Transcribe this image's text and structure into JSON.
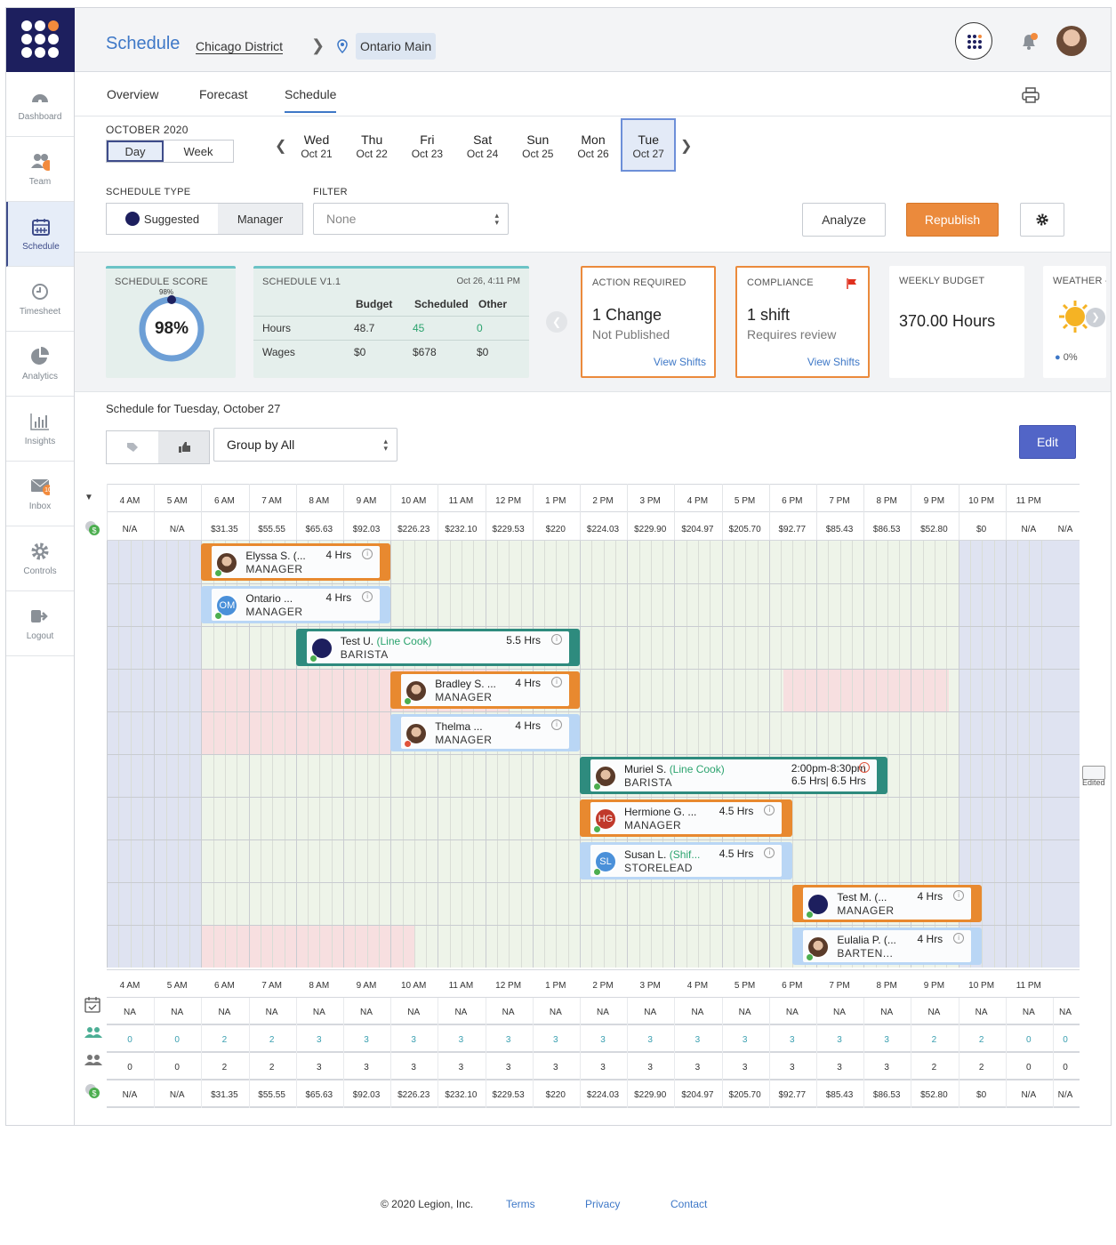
{
  "header": {
    "title": "Schedule",
    "district": "Chicago District",
    "location": "Ontario Main"
  },
  "sidebar": {
    "items": [
      {
        "label": "Dashboard",
        "icon": "dashboard-icon"
      },
      {
        "label": "Team",
        "icon": "team-icon",
        "badge": ""
      },
      {
        "label": "Schedule",
        "icon": "calendar-icon",
        "active": true
      },
      {
        "label": "Timesheet",
        "icon": "clock-icon"
      },
      {
        "label": "Analytics",
        "icon": "pie-chart-icon"
      },
      {
        "label": "Insights",
        "icon": "bar-chart-icon"
      },
      {
        "label": "Inbox",
        "icon": "mail-icon",
        "badge": "10"
      },
      {
        "label": "Controls",
        "icon": "gear-icon"
      },
      {
        "label": "Logout",
        "icon": "logout-icon"
      }
    ]
  },
  "tabs": [
    "Overview",
    "Forecast",
    "Schedule"
  ],
  "period": {
    "month": "OCTOBER 2020",
    "view_day": "Day",
    "view_week": "Week"
  },
  "days": [
    {
      "dow": "Wed",
      "date": "Oct 21"
    },
    {
      "dow": "Thu",
      "date": "Oct 22"
    },
    {
      "dow": "Fri",
      "date": "Oct 23"
    },
    {
      "dow": "Sat",
      "date": "Oct 24"
    },
    {
      "dow": "Sun",
      "date": "Oct 25"
    },
    {
      "dow": "Mon",
      "date": "Oct 26"
    },
    {
      "dow": "Tue",
      "date": "Oct 27",
      "selected": true
    }
  ],
  "controls": {
    "schedule_type_label": "SCHEDULE TYPE",
    "suggested": "Suggested",
    "manager": "Manager",
    "filter_label": "FILTER",
    "filter_value": "None",
    "analyze": "Analyze",
    "republish": "Republish"
  },
  "cards": {
    "score": {
      "title": "SCHEDULE SCORE",
      "small": "98%",
      "value": "98%",
      "fraction": 0.98
    },
    "version": {
      "title": "SCHEDULE V1.1",
      "timestamp": "Oct 26, 4:11 PM",
      "cols": [
        "Budget",
        "Scheduled",
        "Other"
      ],
      "rows": [
        {
          "label": "Hours",
          "values": [
            "48.7",
            "45",
            "0"
          ]
        },
        {
          "label": "Wages",
          "values": [
            "$0",
            "$678",
            "$0"
          ]
        }
      ]
    },
    "action": {
      "title": "ACTION REQUIRED",
      "value": "1 Change",
      "sub": "Not Published",
      "link": "View Shifts"
    },
    "compliance": {
      "title": "COMPLIANCE",
      "value": "1 shift",
      "sub": "Requires review",
      "link": "View Shifts"
    },
    "budget": {
      "title": "WEEKLY BUDGET",
      "value": "370.00 Hours"
    },
    "weather": {
      "title": "WEATHER -",
      "precip": "0%"
    }
  },
  "schedule": {
    "title": "Schedule for Tuesday, October 27",
    "group_by": "Group by All",
    "edit": "Edit",
    "edited": "Edited"
  },
  "hours": [
    "4 AM",
    "5 AM",
    "6 AM",
    "7 AM",
    "8 AM",
    "9 AM",
    "10 AM",
    "11 AM",
    "12 PM",
    "1 PM",
    "2 PM",
    "3 PM",
    "4 PM",
    "5 PM",
    "6 PM",
    "7 PM",
    "8 PM",
    "9 PM",
    "10 PM",
    "11 PM"
  ],
  "top_wages": [
    "N/A",
    "N/A",
    "$31.35",
    "$55.55",
    "$65.63",
    "$92.03",
    "$226.23",
    "$232.10",
    "$229.53",
    "$220",
    "$224.03",
    "$229.90",
    "$204.97",
    "$205.70",
    "$92.77",
    "$85.43",
    "$86.53",
    "$52.80",
    "$0",
    "N/A",
    "N/A"
  ],
  "shifts": [
    {
      "name": "Elyssa S. (...",
      "role": "MANAGER",
      "hrs": "4 Hrs",
      "color": "#e8892f",
      "start": 2,
      "end": 6,
      "avatar": "photo"
    },
    {
      "name": "Ontario ...",
      "role": "MANAGER",
      "hrs": "4 Hrs",
      "color": "#b9d6f5",
      "start": 2,
      "end": 6,
      "avatar": "OM",
      "avcolor": "#4a90d9"
    },
    {
      "name": "Test U.",
      "job": "(Line Cook)",
      "role": "BARISTA",
      "hrs": "5.5 Hrs",
      "color": "#2e8b7e",
      "start": 4,
      "end": 10,
      "avatar": "logo"
    },
    {
      "name": "Bradley S. ...",
      "role": "MANAGER",
      "hrs": "4 Hrs",
      "color": "#e8892f",
      "start": 6,
      "end": 10,
      "avatar": "photo"
    },
    {
      "name": "Thelma ...",
      "role": "MANAGER",
      "hrs": "4 Hrs",
      "color": "#b9d6f5",
      "start": 6,
      "end": 10,
      "avatar": "photo",
      "dot": "#e0533c"
    },
    {
      "name": "Muriel S.",
      "job": "(Line Cook)",
      "role": "BARISTA",
      "hrs": "2:00pm-8:30pm",
      "hrs2": "6.5 Hrs| 6.5 Hrs",
      "color": "#2e8b7e",
      "start": 10,
      "end": 16.5,
      "avatar": "photo",
      "alert": true
    },
    {
      "name": "Hermione G. ...",
      "role": "MANAGER",
      "hrs": "4.5 Hrs",
      "color": "#e8892f",
      "start": 10,
      "end": 14.5,
      "avatar": "HG",
      "avcolor": "#c0392b"
    },
    {
      "name": "Susan L.",
      "job": "(Shif...",
      "role": "STORELEAD",
      "hrs": "4.5 Hrs",
      "color": "#b9d6f5",
      "start": 10,
      "end": 14.5,
      "avatar": "SL",
      "avcolor": "#4a90d9"
    },
    {
      "name": "Test M. (...",
      "role": "MANAGER",
      "hrs": "4 Hrs",
      "color": "#e8892f",
      "start": 14.5,
      "end": 18.5,
      "avatar": "logo"
    },
    {
      "name": "Eulalia P. (...",
      "role": "BARTEN...",
      "hrs": "4 Hrs",
      "color": "#b9d6f5",
      "start": 14.5,
      "end": 18.5,
      "avatar": "photo"
    }
  ],
  "bottom": {
    "na_row": [
      "NA",
      "NA",
      "NA",
      "NA",
      "NA",
      "NA",
      "NA",
      "NA",
      "NA",
      "NA",
      "NA",
      "NA",
      "NA",
      "NA",
      "NA",
      "NA",
      "NA",
      "NA",
      "NA",
      "NA",
      "NA"
    ],
    "suggested_row": [
      "0",
      "0",
      "2",
      "2",
      "3",
      "3",
      "3",
      "3",
      "3",
      "3",
      "3",
      "3",
      "3",
      "3",
      "3",
      "3",
      "3",
      "2",
      "2",
      "0",
      "0"
    ],
    "scheduled_row": [
      "0",
      "0",
      "2",
      "2",
      "3",
      "3",
      "3",
      "3",
      "3",
      "3",
      "3",
      "3",
      "3",
      "3",
      "3",
      "3",
      "3",
      "2",
      "2",
      "0",
      "0"
    ],
    "wages_row": [
      "N/A",
      "N/A",
      "$31.35",
      "$55.55",
      "$65.63",
      "$92.03",
      "$226.23",
      "$232.10",
      "$229.53",
      "$220",
      "$224.03",
      "$229.90",
      "$204.97",
      "$205.70",
      "$92.77",
      "$85.43",
      "$86.53",
      "$52.80",
      "$0",
      "N/A",
      "N/A"
    ]
  },
  "footer": {
    "copyright": "© 2020 Legion, Inc.",
    "terms": "Terms",
    "privacy": "Privacy",
    "contact": "Contact"
  }
}
